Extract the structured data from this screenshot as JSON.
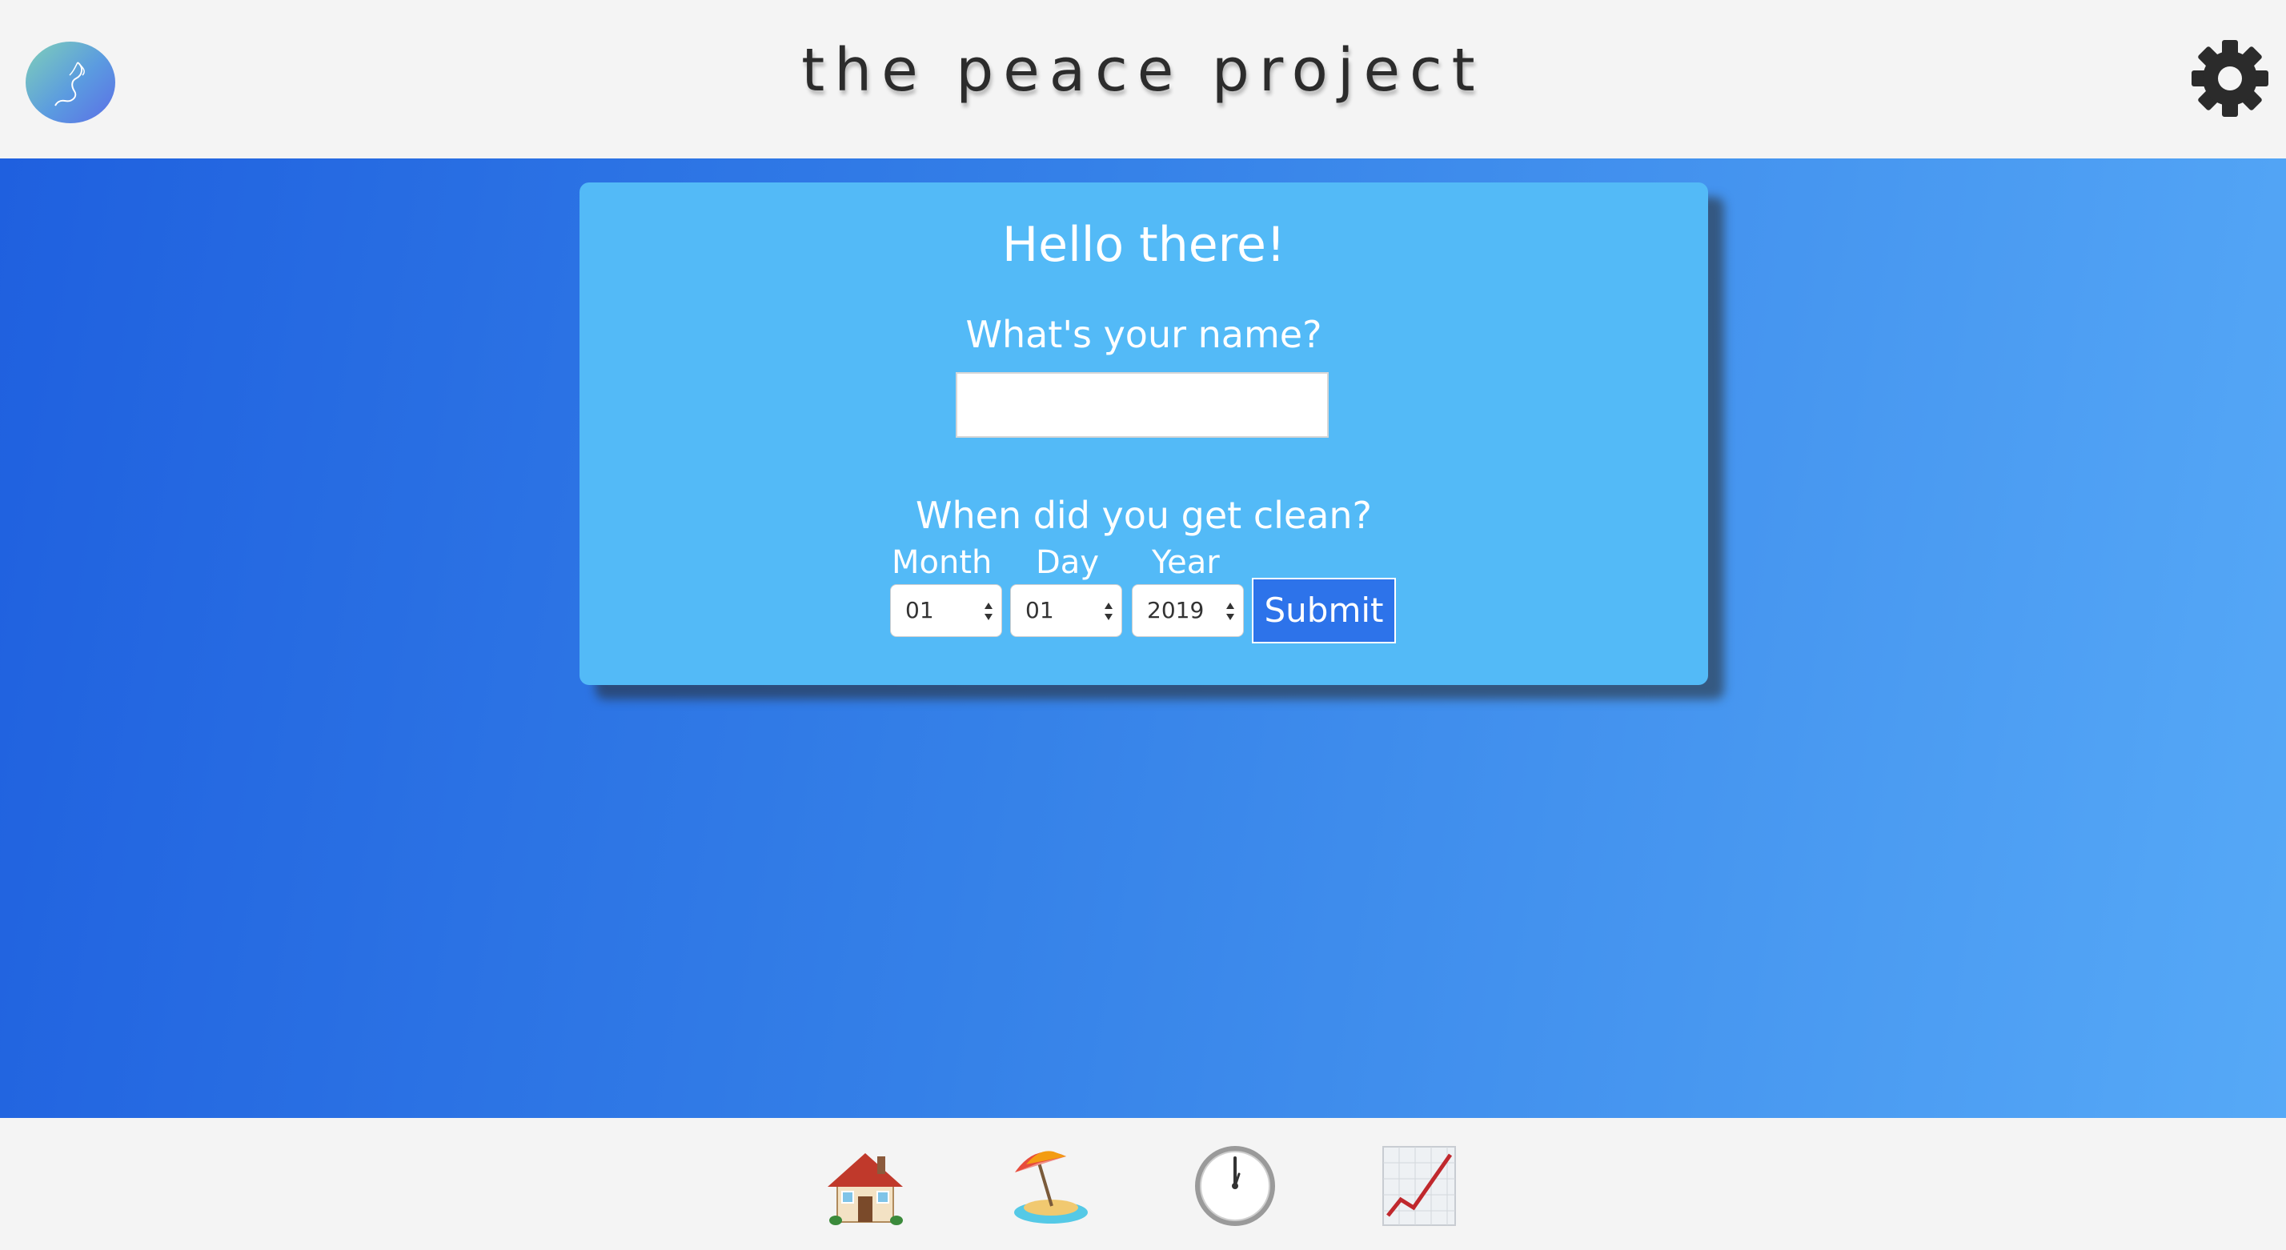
{
  "app": {
    "title": "the peace project"
  },
  "header": {
    "logo_icon": "feather-logo-icon",
    "settings_icon": "gear-icon"
  },
  "card": {
    "greeting": "Hello there!",
    "name_question": "What's your name?",
    "name_value": "",
    "clean_question": "When did you get clean?",
    "month_label": "Month",
    "day_label": "Day",
    "year_label": "Year",
    "month_value": "01",
    "day_value": "01",
    "year_value": "2019",
    "submit_label": "Submit"
  },
  "footer_nav": {
    "items": [
      {
        "icon": "house-icon"
      },
      {
        "icon": "beach-umbrella-icon"
      },
      {
        "icon": "clock-icon"
      },
      {
        "icon": "chart-increasing-icon"
      }
    ]
  },
  "colors": {
    "header_bg": "#f4f4f4",
    "card_bg": "#53baf7",
    "gradient_start": "#1f60df",
    "gradient_end": "#56a9f7",
    "submit_bg": "#2d73ea"
  }
}
